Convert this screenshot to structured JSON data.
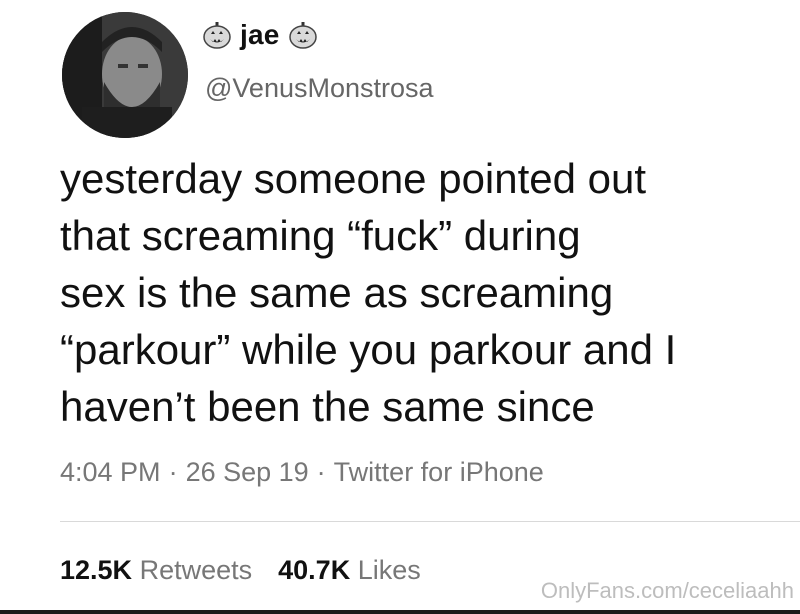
{
  "user": {
    "display_name": "jae",
    "handle": "@VenusMonstrosa"
  },
  "tweet": {
    "lines": [
      "yesterday someone pointed out",
      "that screaming “fuck” during",
      "sex is the same as screaming",
      "“parkour” while you parkour and I",
      "haven’t been the same since"
    ],
    "time": "4:04 PM",
    "date": "26 Sep 19",
    "source": "Twitter for iPhone",
    "separator": "·"
  },
  "stats": {
    "retweets_count": "12.5K",
    "retweets_label": "Retweets",
    "likes_count": "40.7K",
    "likes_label": "Likes"
  },
  "watermark": "OnlyFans.com/ceceliaahh",
  "icons": {
    "avatar": "profile-photo",
    "name_decoration": "jack-o-lantern-icon"
  }
}
